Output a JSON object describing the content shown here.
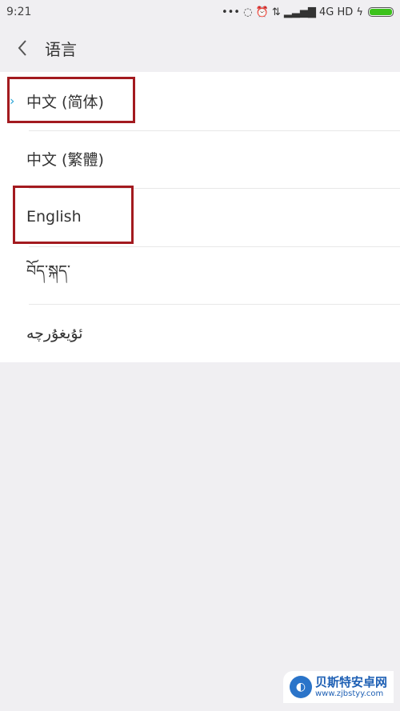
{
  "status_bar": {
    "time": "9:21",
    "indicators": "••• ◌ ⏰ ⇅ ▂▃▅▇ 4G HD ϟ",
    "battery_level": 1.0
  },
  "header": {
    "back_icon": "chevron-left-icon",
    "title": "语言"
  },
  "languages": [
    {
      "label": "中文 (简体)",
      "selected": true,
      "highlighted": true
    },
    {
      "label": "中文 (繁體)",
      "selected": false,
      "highlighted": false
    },
    {
      "label": "English",
      "selected": false,
      "highlighted": true
    },
    {
      "label": "བོད་སྐད་",
      "selected": false,
      "highlighted": false
    },
    {
      "label": "ئۇيغۇرچە",
      "selected": false,
      "highlighted": false
    }
  ],
  "colors": {
    "accent_check": "#2aa4d6",
    "highlight_box": "#a31a1f"
  },
  "watermark": {
    "name": "贝斯特安卓网",
    "url": "www.zjbstyy.com"
  }
}
